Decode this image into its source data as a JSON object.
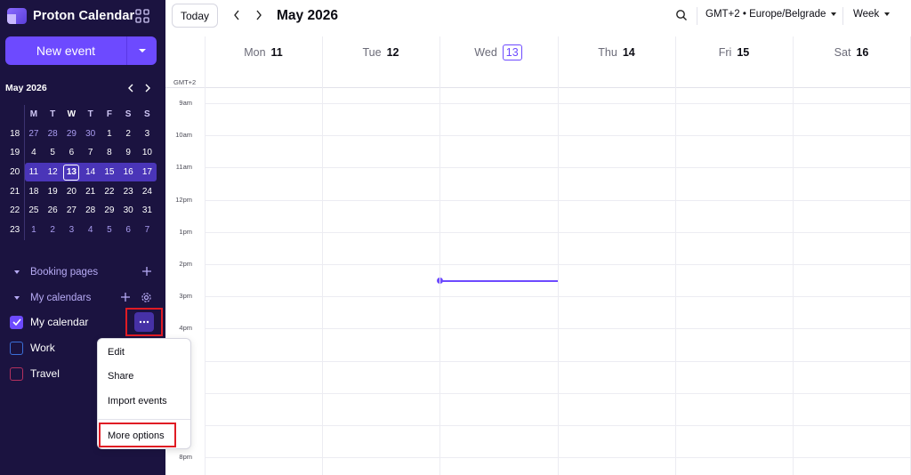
{
  "app": {
    "name": "Proton Calendar",
    "new_event_label": "New event"
  },
  "mini_calendar": {
    "title": "May 2026",
    "weekday_headers": [
      "M",
      "T",
      "W",
      "T",
      "F",
      "S",
      "S"
    ],
    "weeks": [
      {
        "week": "18",
        "days": [
          "27",
          "28",
          "29",
          "30",
          "1",
          "2",
          "3"
        ]
      },
      {
        "week": "19",
        "days": [
          "4",
          "5",
          "6",
          "7",
          "8",
          "9",
          "10"
        ]
      },
      {
        "week": "20",
        "days": [
          "11",
          "12",
          "13",
          "14",
          "15",
          "16",
          "17"
        ]
      },
      {
        "week": "21",
        "days": [
          "18",
          "19",
          "20",
          "21",
          "22",
          "23",
          "24"
        ]
      },
      {
        "week": "22",
        "days": [
          "25",
          "26",
          "27",
          "28",
          "29",
          "30",
          "31"
        ]
      },
      {
        "week": "23",
        "days": [
          "1",
          "2",
          "3",
          "4",
          "5",
          "6",
          "7"
        ]
      }
    ],
    "selected_week_index": 2,
    "today_day_index": 2
  },
  "sidebar": {
    "booking_pages_label": "Booking pages",
    "my_calendars_label": "My calendars",
    "calendars": [
      {
        "name": "My calendar",
        "color": "#6d4aff",
        "checked": true
      },
      {
        "name": "Work",
        "color": "#3b6fd8",
        "checked": false
      },
      {
        "name": "Travel",
        "color": "#b3305e",
        "checked": false
      }
    ]
  },
  "context_menu": {
    "items": [
      "Edit",
      "Share",
      "Import events"
    ],
    "more_options": "More options"
  },
  "toolbar": {
    "today_label": "Today",
    "title": "May 2026",
    "timezone": "GMT+2 • Europe/Belgrade",
    "view": "Week"
  },
  "week_view": {
    "gmt_label": "GMT+2",
    "days": [
      {
        "name": "Mon",
        "num": "11",
        "today": false
      },
      {
        "name": "Tue",
        "num": "12",
        "today": false
      },
      {
        "name": "Wed",
        "num": "13",
        "today": true
      },
      {
        "name": "Thu",
        "num": "14",
        "today": false
      },
      {
        "name": "Fri",
        "num": "15",
        "today": false
      },
      {
        "name": "Sat",
        "num": "16",
        "today": false
      }
    ],
    "hours": [
      "9am",
      "10am",
      "11am",
      "12pm",
      "1pm",
      "2pm",
      "3pm",
      "4pm",
      "8pm"
    ]
  },
  "colors": {
    "accent": "#6d4aff",
    "sidebar_bg": "#1b1340",
    "highlight": "#e01b24"
  }
}
